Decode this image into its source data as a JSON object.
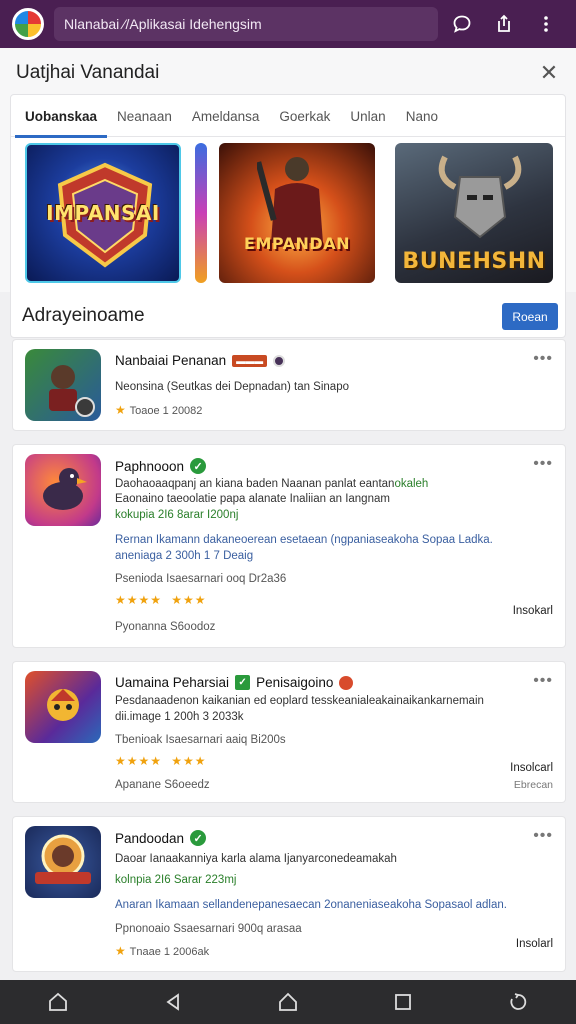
{
  "topbar": {
    "url": "Nlanabai ⁄/Aplikasai Idehengsim"
  },
  "panel": {
    "title": "Uatjhai Vanandai",
    "tabs": [
      "Uobanskaa",
      "Neanaan",
      "Ameldansa",
      "Goerkak",
      "Unlan",
      "Nano"
    ],
    "banners": [
      {
        "text": "IMPANSAI",
        "colors": [
          "#0c2f8a",
          "#3a7bd5"
        ]
      },
      {
        "text": "EMPANDAN",
        "colors": [
          "#8a2a0c",
          "#f58a25"
        ]
      },
      {
        "text": "BUNEHSHN",
        "colors": [
          "#2b2d38",
          "#7a6a5a"
        ]
      }
    ]
  },
  "section": {
    "title": "Adrayeinoame",
    "button": "Roean"
  },
  "apps": [
    {
      "title": "Nanbaiai Penanan",
      "line1": "Neonsina (Seutkas dei Depnadan) tan Sinapo",
      "rating": "Toaoe 1 20082"
    },
    {
      "title": "Paphnooon",
      "line1": "Daohaoaaqpanj an kiana baden Naanan panlat eantan",
      "line1_tail": "okaleh",
      "line2": "Eaonaino taeoolatie papa alanate Inaliian an Iangnam",
      "line3": "kokupia 2I6 8arar I200nj",
      "line4": "Rernan Ikamann dakaneoerean esetaean (ngpaniaseakoha Sopaa Ladka.",
      "line5": "aneniaga 2 300h 1 7 Deaig",
      "line6": "Psenioda Isaesarnari ooq Dr2a36",
      "rating_left": "★★★★",
      "rating_right": "★★★",
      "footer": "Pyonanna S6oodoz",
      "install": "Insokarl"
    },
    {
      "title": "Uamaina Peharsiai",
      "title2": "Penisaigoino",
      "line1": "Pesdanaadenon kaikanian ed eoplard tesskeanialeakainaikankarnemain",
      "line2": "dii.image 1 200h 3 2033k",
      "line3": "Tbenioak Isaesarnari aaiq Bi200s",
      "stars": "★★★★",
      "stars2": "★★★",
      "footer": "Apanane S6oeedz",
      "install": "Insolcarl",
      "install2": "Ebrecan"
    },
    {
      "title": "Pandoodan",
      "line1": "Daoar Ianaakanniya karla alama Ijanyarconedeamakah",
      "line2": "kolnpia 2I6 Sarar 223mj",
      "line3": "Anaran Ikamaan sellandenepanesaecan 2onaneniaseakoha Sopasaol adlan.",
      "line4": "Ppnonoaio Ssaesarnari 900q arasaa",
      "rating": "Tnaae 1 2006ak",
      "install": "Insolarl"
    }
  ],
  "colors": {
    "topbar": "#4a1f52",
    "accent": "#2d6ac4",
    "verified": "#2a9a3c",
    "star": "#f0a20e"
  }
}
